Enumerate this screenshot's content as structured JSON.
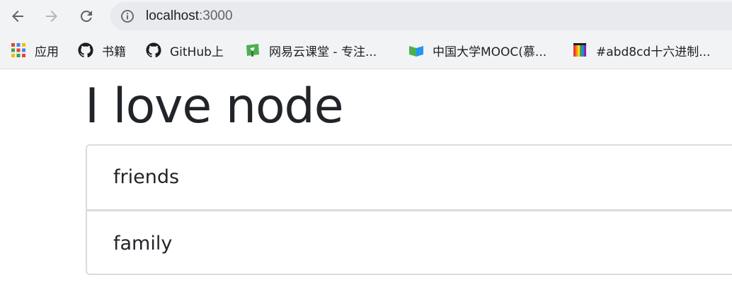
{
  "browser": {
    "address": {
      "host": "localhost",
      "port": ":3000"
    },
    "bookmarks": [
      {
        "label": "应用",
        "icon": "apps-grid-icon"
      },
      {
        "label": "书籍",
        "icon": "github-icon"
      },
      {
        "label": "GitHub上",
        "icon": "github-icon"
      },
      {
        "label": "网易云课堂 - 专注...",
        "icon": "netease-study-icon"
      },
      {
        "label": "中国大学MOOC(慕...",
        "icon": "mooc-icon"
      },
      {
        "label": "#abd8cd十六进制...",
        "icon": "rainbow-book-icon"
      }
    ]
  },
  "page": {
    "title": "I love node",
    "items": [
      "friends",
      "family"
    ]
  },
  "colors": {
    "text": "#212529",
    "border": "#dcdcdc",
    "chrome_bg": "#f1f3f4"
  }
}
